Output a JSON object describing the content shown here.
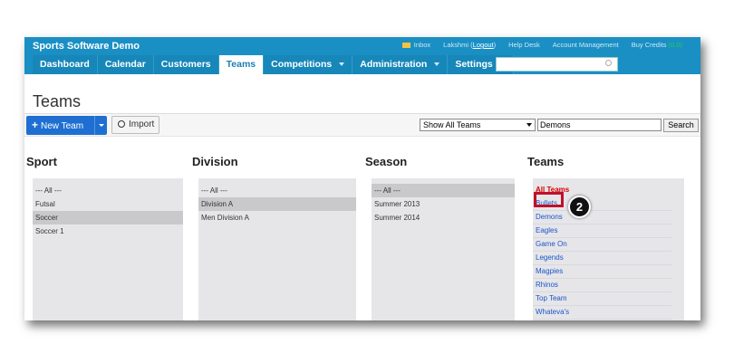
{
  "app": {
    "title": "Sports Software Demo"
  },
  "top_links": {
    "inbox": "Inbox",
    "user": "Lakshmi",
    "logout": "Logout",
    "help": "Help Desk",
    "account": "Account Management",
    "buy_credits": "Buy Credits",
    "credits": "(0.0)"
  },
  "nav": {
    "items": [
      {
        "label": "Dashboard"
      },
      {
        "label": "Calendar"
      },
      {
        "label": "Customers"
      },
      {
        "label": "Teams"
      },
      {
        "label": "Competitions"
      },
      {
        "label": "Administration"
      },
      {
        "label": "Settings"
      }
    ]
  },
  "page": {
    "title": "Teams"
  },
  "toolbar": {
    "new_team": "New Team",
    "import": "Import",
    "filter_value": "Show All Teams",
    "search_value": "Demons",
    "search_button": "Search"
  },
  "columns": {
    "sport": {
      "title": "Sport",
      "items": [
        "--- All ---",
        "Futsal",
        "Soccer",
        "Soccer 1"
      ]
    },
    "division": {
      "title": "Division",
      "items": [
        "--- All ---",
        "Division A",
        "Men Division A"
      ]
    },
    "season": {
      "title": "Season",
      "items": [
        "--- All ---",
        "Summer 2013",
        "Summer 2014"
      ]
    },
    "teams": {
      "title": "Teams",
      "items": [
        "All Teams",
        "Bullets",
        "Demons",
        "Eagles",
        "Game On",
        "Legends",
        "Magpies",
        "Rhinos",
        "Top Team",
        "Whateva's"
      ]
    }
  },
  "callout": {
    "step": "2"
  },
  "colors": {
    "topbar": "#1a8fc4",
    "primary_button": "#1e6fd1",
    "highlight": "#c0102a"
  }
}
